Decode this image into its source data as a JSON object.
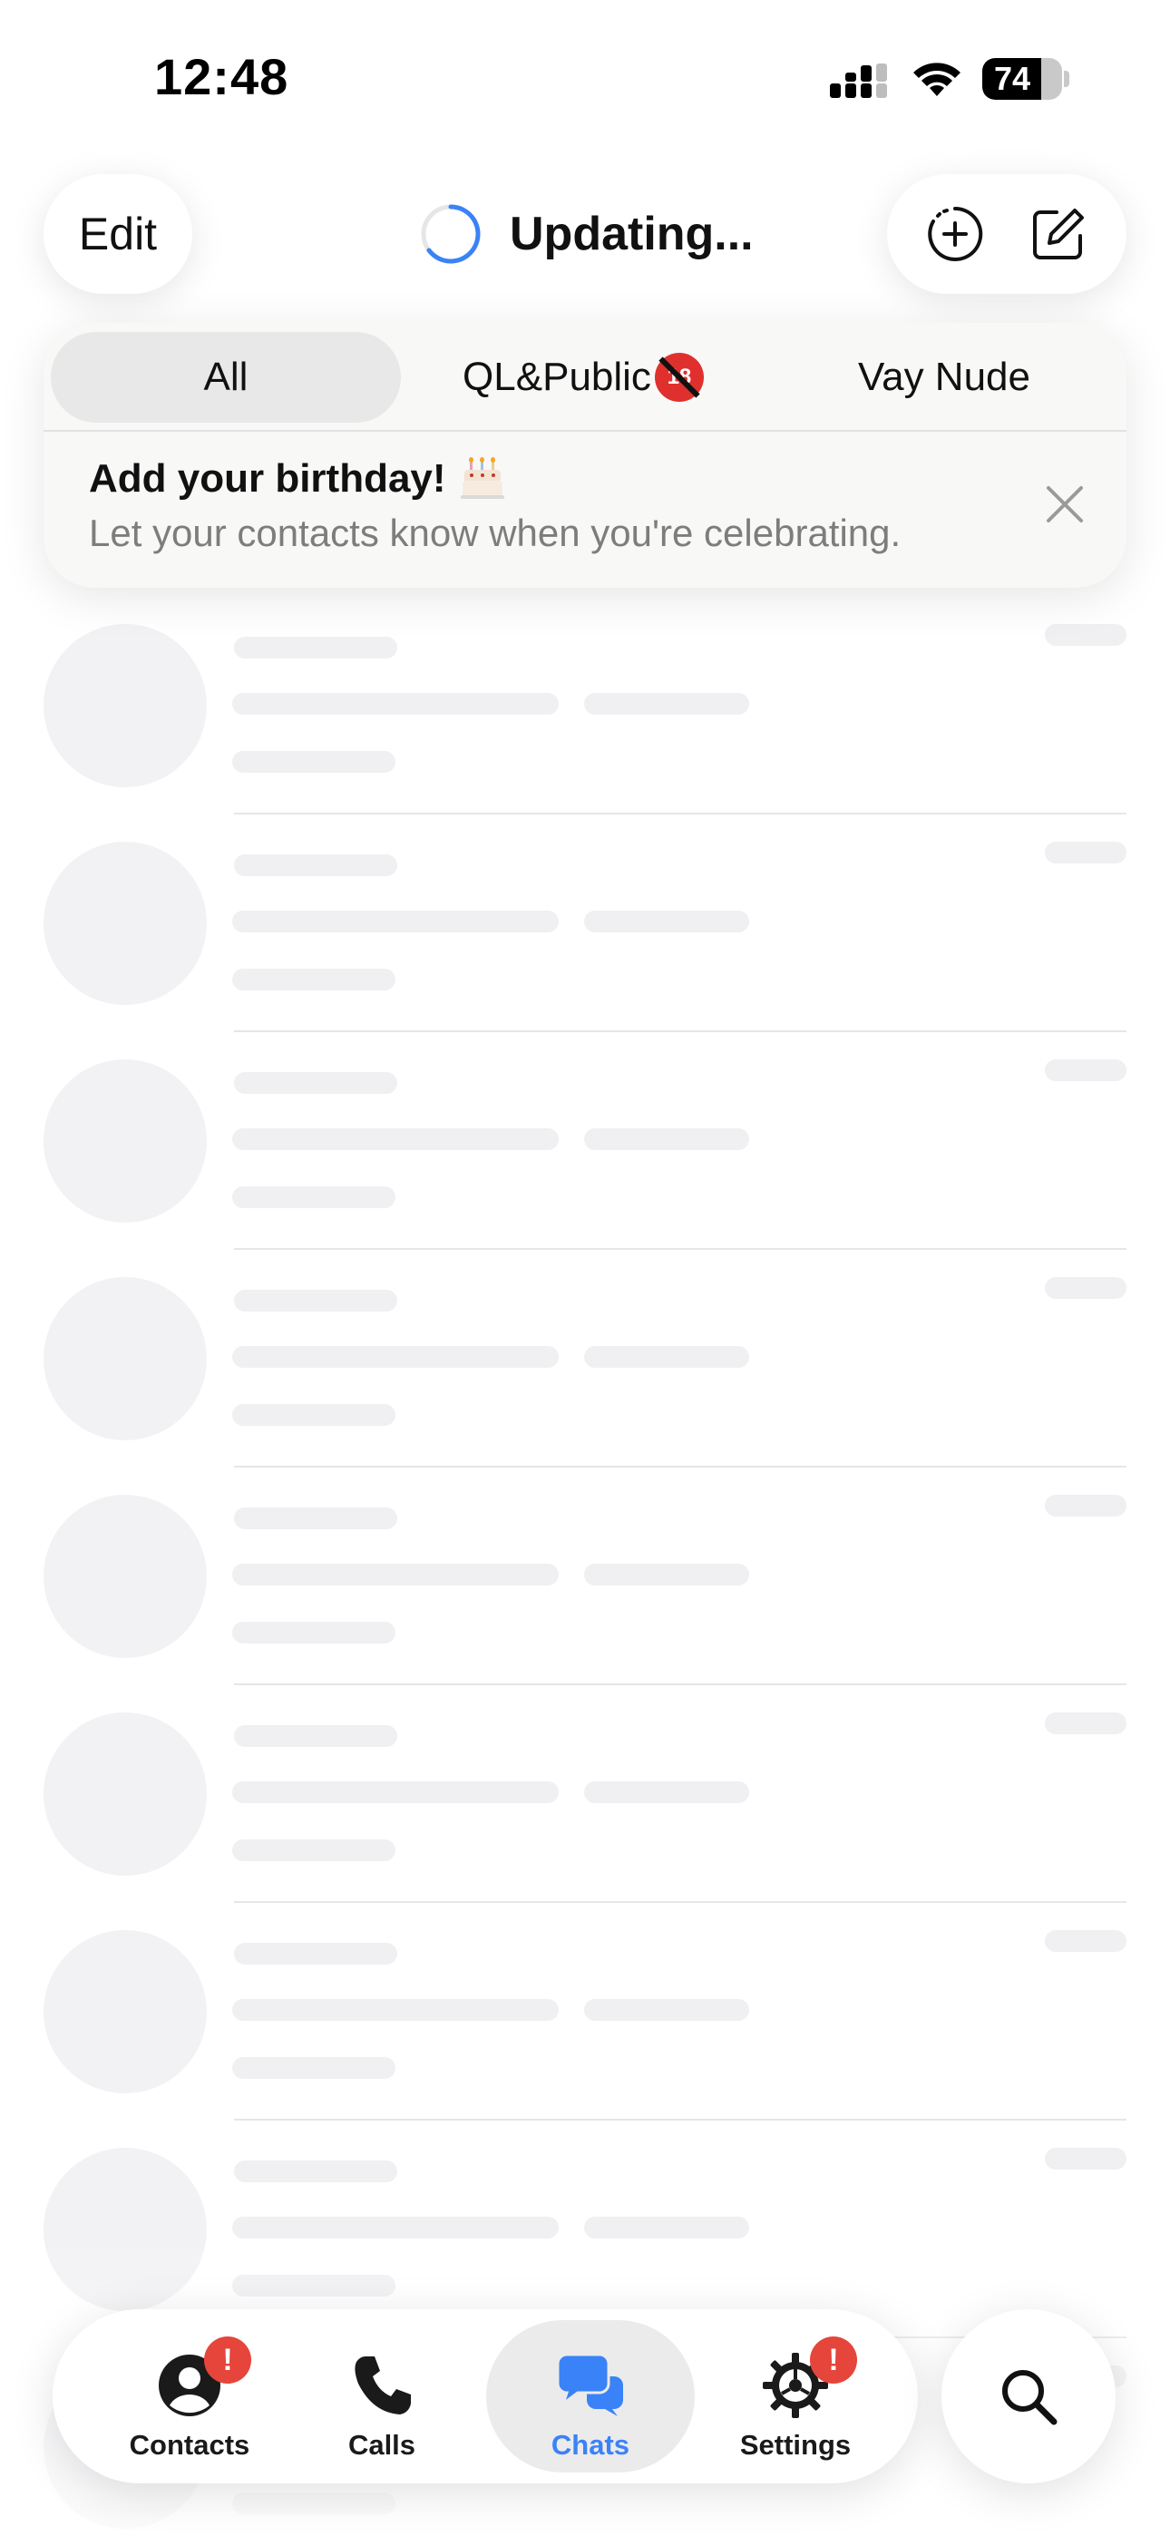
{
  "status_bar": {
    "time": "12:48",
    "battery_level": "74"
  },
  "header": {
    "edit_label": "Edit",
    "title": "Updating...",
    "icons": [
      "new-story-icon",
      "compose-icon"
    ]
  },
  "filters": {
    "tabs": [
      {
        "label": "All",
        "active": true
      },
      {
        "label": "QL&Public",
        "suffix_icon": "no-under-18-emoji",
        "active": false
      },
      {
        "label": "Vay Nude",
        "active": false
      }
    ]
  },
  "banner": {
    "title": "Add your birthday!",
    "title_icon": "birthday-cake-emoji",
    "subtitle": "Let your contacts know when you're celebrating."
  },
  "chat_list": {
    "state": "loading-skeleton",
    "placeholder_rows": 9
  },
  "tabbar": {
    "items": [
      {
        "label": "Contacts",
        "icon": "person-circle-icon",
        "badge": "!",
        "active": false
      },
      {
        "label": "Calls",
        "icon": "phone-icon",
        "badge": "",
        "active": false
      },
      {
        "label": "Chats",
        "icon": "chat-bubbles-icon",
        "badge": "",
        "active": true
      },
      {
        "label": "Settings",
        "icon": "gear-icon",
        "badge": "!",
        "active": false
      }
    ],
    "search_icon": "search-icon"
  },
  "colors": {
    "accent": "#3a82f7",
    "badge": "#e5453a",
    "skeleton": "#f0f0f3",
    "secondary_text": "#7d7d7d"
  }
}
